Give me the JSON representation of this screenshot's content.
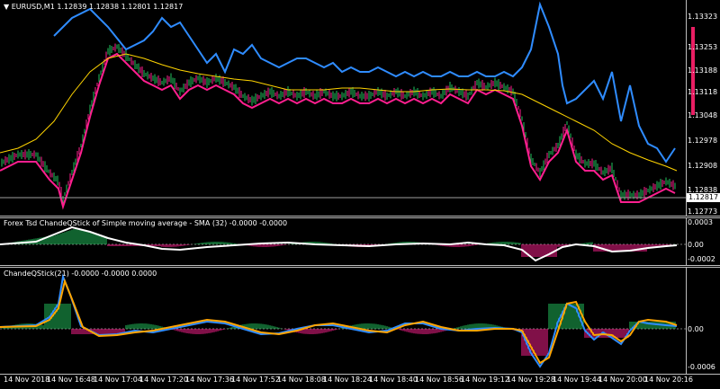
{
  "main": {
    "symbol_label": "EURUSD,M1",
    "ohlc": "1.12839 1.12838 1.12801 1.12817",
    "price_ticks": [
      "1.13323",
      "1.13253",
      "1.13188",
      "1.13118",
      "1.13048",
      "1.12978",
      "1.12908",
      "1.12838",
      "1.12773"
    ],
    "current_price": "1.12817"
  },
  "ind1": {
    "title": "Forex Tsd ChandeQStick of Simple moving average - SMA (32) -0.0000 -0.0000",
    "ticks": [
      "0.0003",
      "0.00",
      "-0.0002"
    ]
  },
  "ind2": {
    "title": "ChandeQStick(21) -0.0000 -0.0000 0.0000",
    "ticks": [
      "0.00",
      "-0.0006"
    ]
  },
  "time_axis": [
    "14 Nov 2018",
    "14 Nov 16:48",
    "14 Nov 17:04",
    "14 Nov 17:20",
    "14 Nov 17:36",
    "14 Nov 17:52",
    "14 Nov 18:08",
    "14 Nov 18:24",
    "14 Nov 18:40",
    "14 Nov 18:56",
    "14 Nov 19:12",
    "14 Nov 19:28",
    "14 Nov 19:44",
    "14 Nov 20:00",
    "14 Nov 20:16"
  ],
  "colors": {
    "up": "#22c55e",
    "down": "#ff1f8f",
    "blue": "#2f8cff",
    "orange": "#ffa500",
    "sma": "#ffd400"
  }
}
